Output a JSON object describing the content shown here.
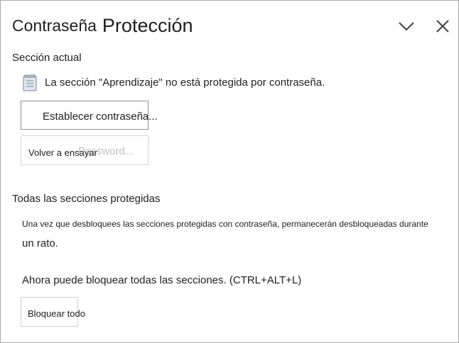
{
  "header": {
    "title_part1": "Contraseña",
    "title_part2": "Protección",
    "collapse_icon": "chevron-down-icon",
    "close_icon": "close-icon"
  },
  "current_section": {
    "label": "Sección actual",
    "status_icon": "notebook-section-icon",
    "status_text": "La sección \"Aprendizaje\" no está protegida por contraseña.",
    "set_password_label": "Establecer contraseña...",
    "ghost_label": "Password...",
    "retry_label": "Volver a ensayar"
  },
  "all_protected": {
    "title": "Todas las secciones protegidas",
    "description_line1": "Una vez que desbloquees las secciones protegidas con contraseña, permanecerán desbloqueadas durante",
    "description_line2": "un rato.",
    "lock_info": "Ahora puede bloquear todas las secciones. (CTRL+ALT+L)",
    "lock_all_label": "Bloquear todo"
  }
}
